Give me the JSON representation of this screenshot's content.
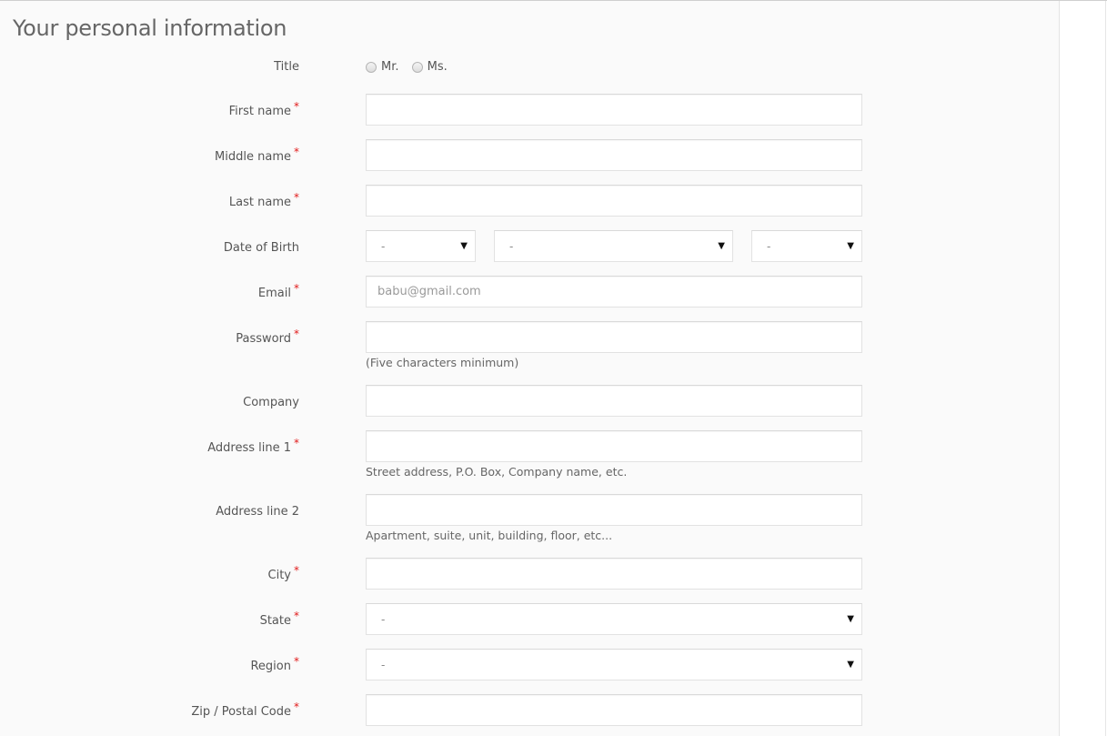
{
  "form": {
    "heading": "Your personal information",
    "required_marker": "*",
    "title": {
      "label": "Title",
      "options": [
        "Mr.",
        "Ms."
      ]
    },
    "first_name": {
      "label": "First name",
      "value": ""
    },
    "middle_name": {
      "label": "Middle name",
      "value": ""
    },
    "last_name": {
      "label": "Last name",
      "value": ""
    },
    "dob": {
      "label": "Date of Birth",
      "day": "-",
      "month": "-",
      "year": "-"
    },
    "email": {
      "label": "Email",
      "placeholder": "babu@gmail.com"
    },
    "password": {
      "label": "Password",
      "hint": "(Five characters minimum)"
    },
    "company": {
      "label": "Company",
      "value": ""
    },
    "address1": {
      "label": "Address line 1",
      "hint": "Street address, P.O. Box, Company name, etc."
    },
    "address2": {
      "label": "Address line 2",
      "hint": "Apartment, suite, unit, building, floor, etc..."
    },
    "city": {
      "label": "City",
      "value": ""
    },
    "state": {
      "label": "State",
      "value": "-"
    },
    "region": {
      "label": "Region",
      "value": "-"
    },
    "zip": {
      "label": "Zip / Postal Code",
      "value": ""
    }
  },
  "icons": {
    "caret": "▼",
    "radio": "radio-icon"
  }
}
